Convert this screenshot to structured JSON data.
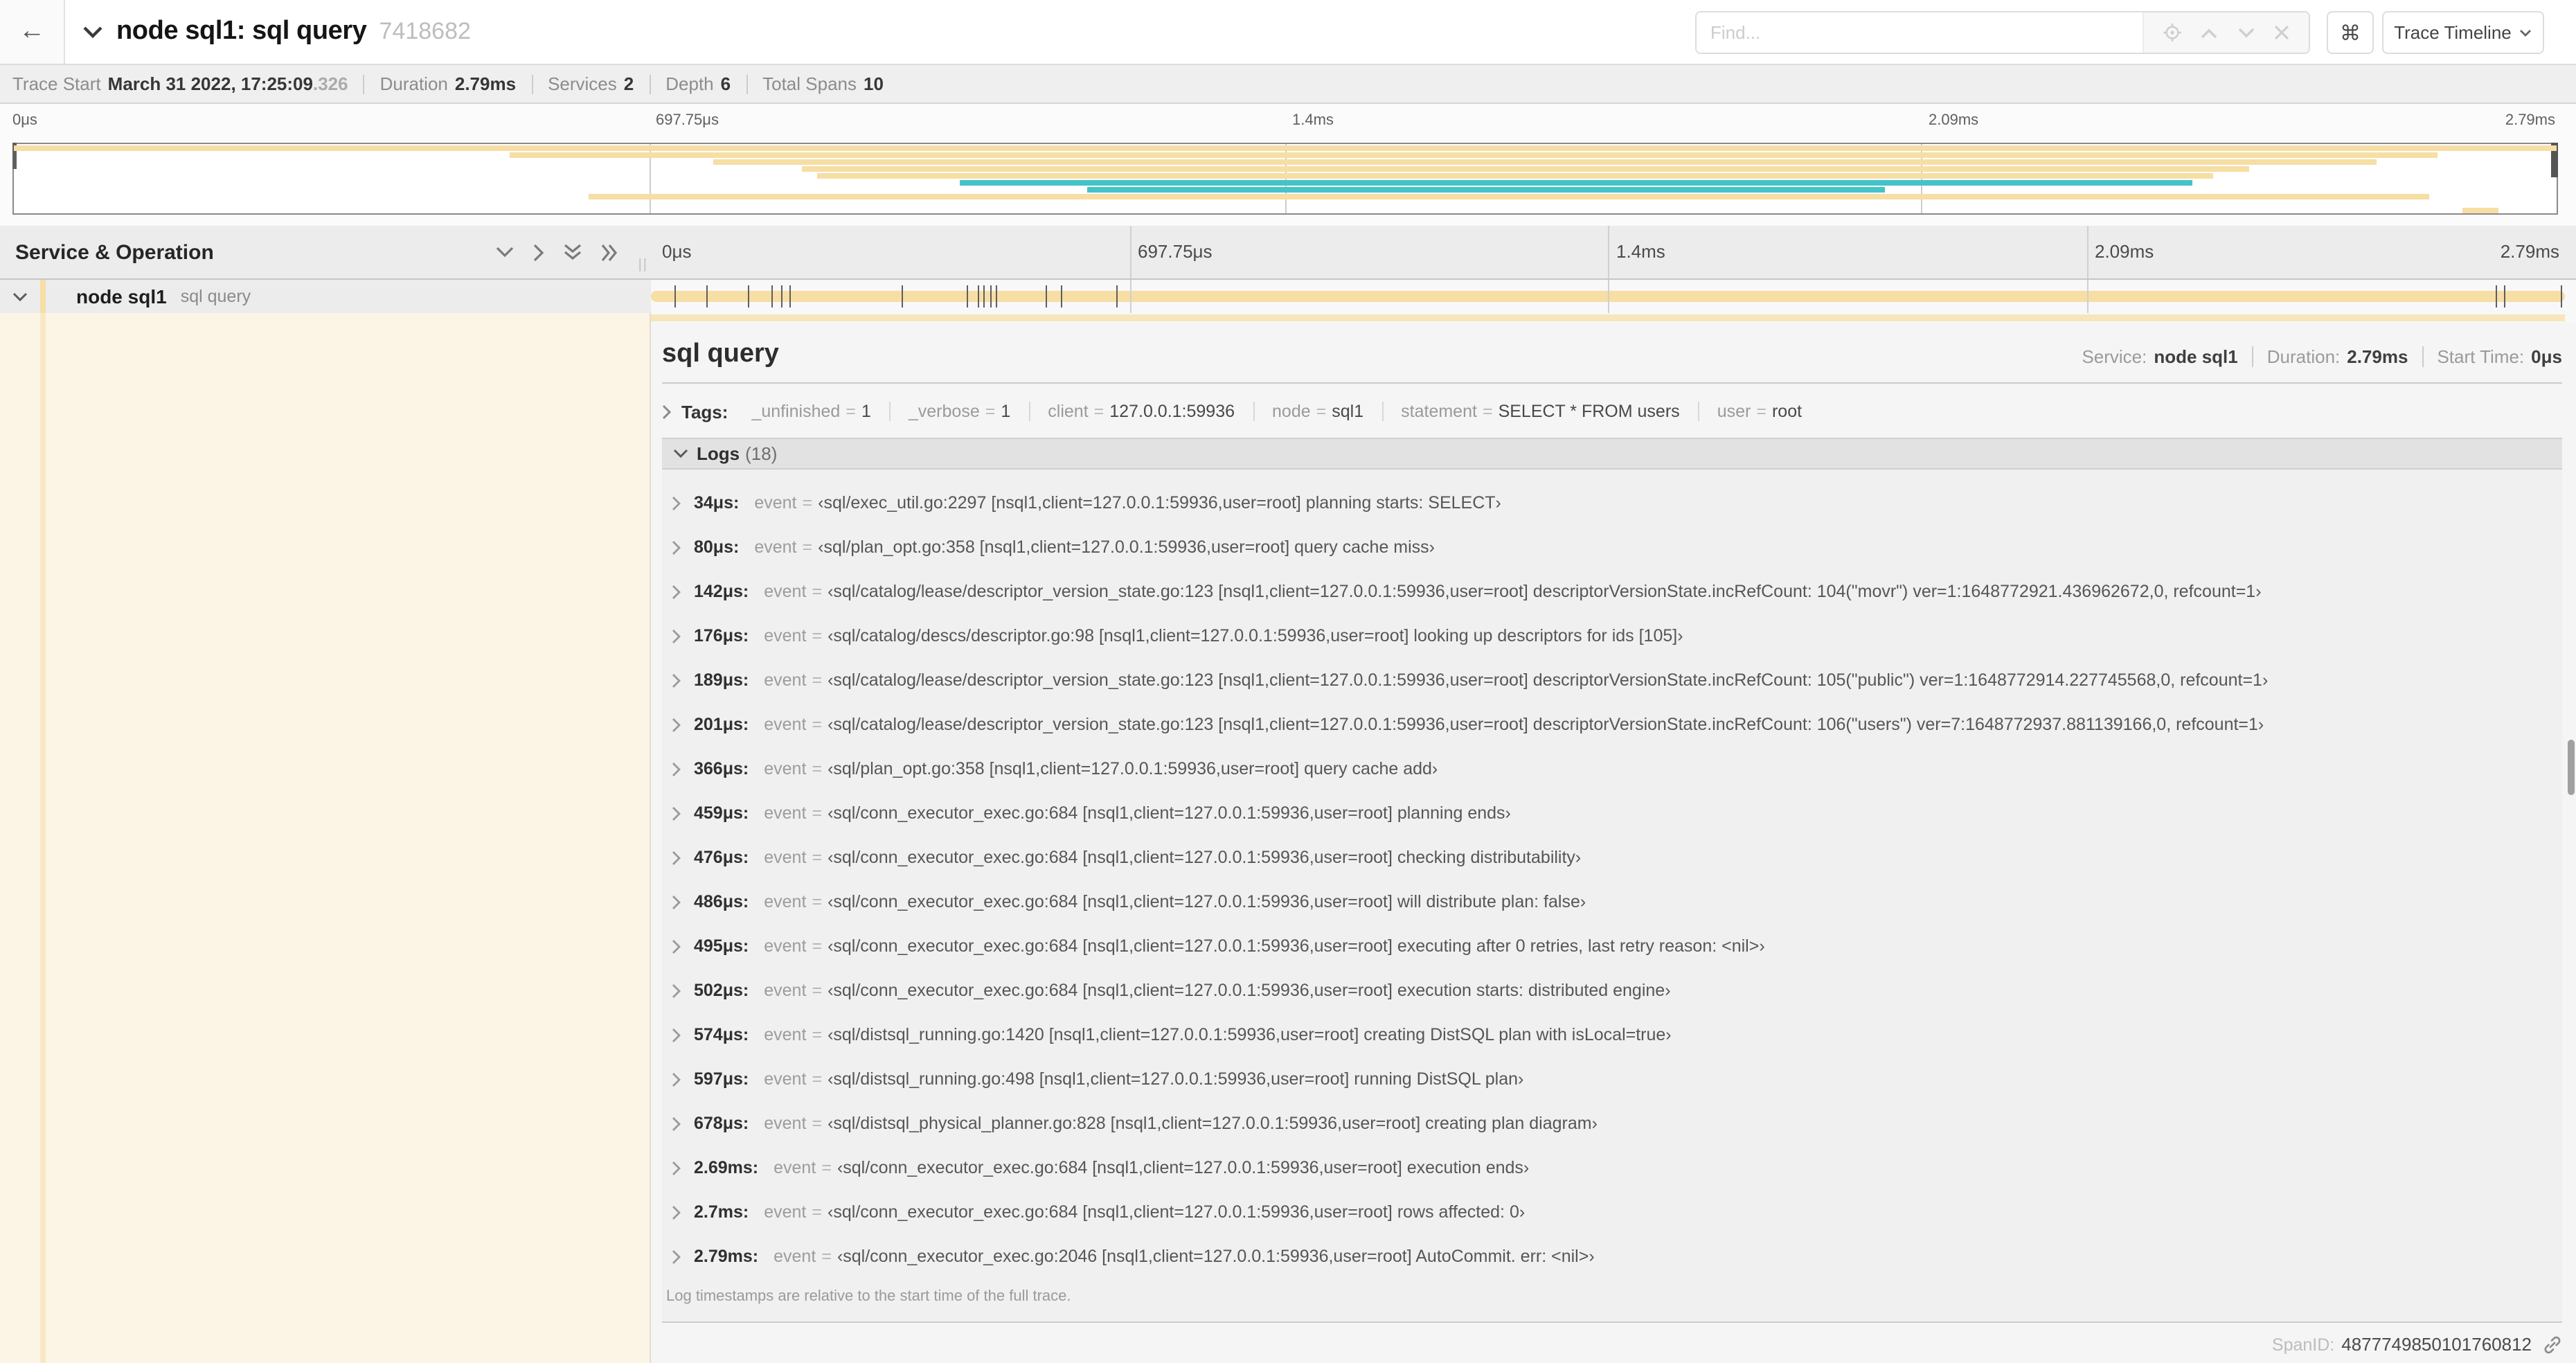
{
  "colors": {
    "tan": "#F6DEA4",
    "tan_light": "#F8E5BC",
    "teal": "#44C3C9",
    "cream": "#FCF4E4",
    "accent": "#F2D38B"
  },
  "header": {
    "back_icon": "←",
    "title": "node sql1: sql query",
    "trace_id": "7418682",
    "find_placeholder": "Find...",
    "shortcut_key": "⌘",
    "view_button_label": "Trace Timeline"
  },
  "trace_info": [
    {
      "label": "Trace Start",
      "value": "March 31 2022, 17:25:09",
      "suffix": ".326"
    },
    {
      "label": "Duration",
      "value": "2.79ms"
    },
    {
      "label": "Services",
      "value": "2"
    },
    {
      "label": "Depth",
      "value": "6"
    },
    {
      "label": "Total Spans",
      "value": "10"
    }
  ],
  "minimap": {
    "ticks": [
      {
        "t": "0μs",
        "p": 0
      },
      {
        "t": "697.75μs",
        "p": 25
      },
      {
        "t": "1.4ms",
        "p": 50
      },
      {
        "t": "2.09ms",
        "p": 75
      },
      {
        "t": "2.79ms",
        "p": 100
      }
    ],
    "gridlines_pct": [
      25,
      50,
      75
    ],
    "bars": [
      {
        "row": 0,
        "s": 0,
        "e": 100,
        "c": "tan"
      },
      {
        "row": 1,
        "s": 19.5,
        "e": 95.3,
        "c": "tan"
      },
      {
        "row": 2,
        "s": 27.5,
        "e": 92.9,
        "c": "tan"
      },
      {
        "row": 3,
        "s": 31.0,
        "e": 87.9,
        "c": "tan"
      },
      {
        "row": 4,
        "s": 31.6,
        "e": 86.5,
        "c": "tan"
      },
      {
        "row": 5,
        "s": 37.2,
        "e": 85.7,
        "c": "teal"
      },
      {
        "row": 6,
        "s": 42.2,
        "e": 73.6,
        "c": "teal"
      },
      {
        "row": 7,
        "s": 22.6,
        "e": 95.0,
        "c": "tan"
      },
      {
        "row": 9,
        "s": 96.3,
        "e": 97.7,
        "c": "tan"
      }
    ]
  },
  "timeline": {
    "left_title": "Service & Operation",
    "ticks": [
      {
        "t": "0μs",
        "p": 0
      },
      {
        "t": "697.75μs",
        "p": 25
      },
      {
        "t": "1.4ms",
        "p": 50
      },
      {
        "t": "2.09ms",
        "p": 75
      },
      {
        "t": "2.79ms",
        "p": 100
      }
    ],
    "gridlines_pct": [
      25,
      50,
      75
    ],
    "span_row": {
      "service": "node sql1",
      "operation": "sql query"
    },
    "log_markers_pct": [
      1.2,
      2.9,
      5.1,
      6.3,
      6.8,
      7.2,
      13.1,
      16.5,
      17.1,
      17.4,
      17.7,
      18.0,
      20.6,
      21.4,
      24.3,
      96.4,
      96.8,
      99.8
    ]
  },
  "detail": {
    "title": "sql query",
    "meta": [
      {
        "label": "Service:",
        "value": "node sql1"
      },
      {
        "label": "Duration:",
        "value": "2.79ms"
      },
      {
        "label": "Start Time:",
        "value": "0μs"
      }
    ],
    "tags_label": "Tags:",
    "tags": [
      {
        "key": "_unfinished",
        "value": "1"
      },
      {
        "key": "_verbose",
        "value": "1"
      },
      {
        "key": "client",
        "value": "127.0.0.1:59936"
      },
      {
        "key": "node",
        "value": "sql1"
      },
      {
        "key": "statement",
        "value": "SELECT * FROM users"
      },
      {
        "key": "user",
        "value": "root"
      }
    ],
    "logs_label": "Logs",
    "logs_count": "(18)",
    "log_field_key": "event",
    "logs": [
      {
        "time": "34μs:",
        "value": "‹sql/exec_util.go:2297 [nsql1,client=127.0.0.1:59936,user=root] planning starts: SELECT›"
      },
      {
        "time": "80μs:",
        "value": "‹sql/plan_opt.go:358 [nsql1,client=127.0.0.1:59936,user=root] query cache miss›"
      },
      {
        "time": "142μs:",
        "value": "‹sql/catalog/lease/descriptor_version_state.go:123 [nsql1,client=127.0.0.1:59936,user=root] descriptorVersionState.incRefCount: 104(\"movr\") ver=1:1648772921.436962672,0, refcount=1›"
      },
      {
        "time": "176μs:",
        "value": "‹sql/catalog/descs/descriptor.go:98 [nsql1,client=127.0.0.1:59936,user=root] looking up descriptors for ids [105]›"
      },
      {
        "time": "189μs:",
        "value": "‹sql/catalog/lease/descriptor_version_state.go:123 [nsql1,client=127.0.0.1:59936,user=root] descriptorVersionState.incRefCount: 105(\"public\") ver=1:1648772914.227745568,0, refcount=1›"
      },
      {
        "time": "201μs:",
        "value": "‹sql/catalog/lease/descriptor_version_state.go:123 [nsql1,client=127.0.0.1:59936,user=root] descriptorVersionState.incRefCount: 106(\"users\") ver=7:1648772937.881139166,0, refcount=1›"
      },
      {
        "time": "366μs:",
        "value": "‹sql/plan_opt.go:358 [nsql1,client=127.0.0.1:59936,user=root] query cache add›"
      },
      {
        "time": "459μs:",
        "value": "‹sql/conn_executor_exec.go:684 [nsql1,client=127.0.0.1:59936,user=root] planning ends›"
      },
      {
        "time": "476μs:",
        "value": "‹sql/conn_executor_exec.go:684 [nsql1,client=127.0.0.1:59936,user=root] checking distributability›"
      },
      {
        "time": "486μs:",
        "value": "‹sql/conn_executor_exec.go:684 [nsql1,client=127.0.0.1:59936,user=root] will distribute plan: false›"
      },
      {
        "time": "495μs:",
        "value": "‹sql/conn_executor_exec.go:684 [nsql1,client=127.0.0.1:59936,user=root] executing after 0 retries, last retry reason: <nil>›"
      },
      {
        "time": "502μs:",
        "value": "‹sql/conn_executor_exec.go:684 [nsql1,client=127.0.0.1:59936,user=root] execution starts: distributed engine›"
      },
      {
        "time": "574μs:",
        "value": "‹sql/distsql_running.go:1420 [nsql1,client=127.0.0.1:59936,user=root] creating DistSQL plan with isLocal=true›"
      },
      {
        "time": "597μs:",
        "value": "‹sql/distsql_running.go:498 [nsql1,client=127.0.0.1:59936,user=root] running DistSQL plan›"
      },
      {
        "time": "678μs:",
        "value": "‹sql/distsql_physical_planner.go:828 [nsql1,client=127.0.0.1:59936,user=root] creating plan diagram›"
      },
      {
        "time": "2.69ms:",
        "value": "‹sql/conn_executor_exec.go:684 [nsql1,client=127.0.0.1:59936,user=root] execution ends›"
      },
      {
        "time": "2.7ms:",
        "value": "‹sql/conn_executor_exec.go:684 [nsql1,client=127.0.0.1:59936,user=root] rows affected: 0›"
      },
      {
        "time": "2.79ms:",
        "value": "‹sql/conn_executor_exec.go:2046 [nsql1,client=127.0.0.1:59936,user=root] AutoCommit. err: <nil>›"
      }
    ],
    "footer": "Log timestamps are relative to the start time of the full trace.",
    "span_id_label": "SpanID:",
    "span_id": "4877749850101760812"
  }
}
